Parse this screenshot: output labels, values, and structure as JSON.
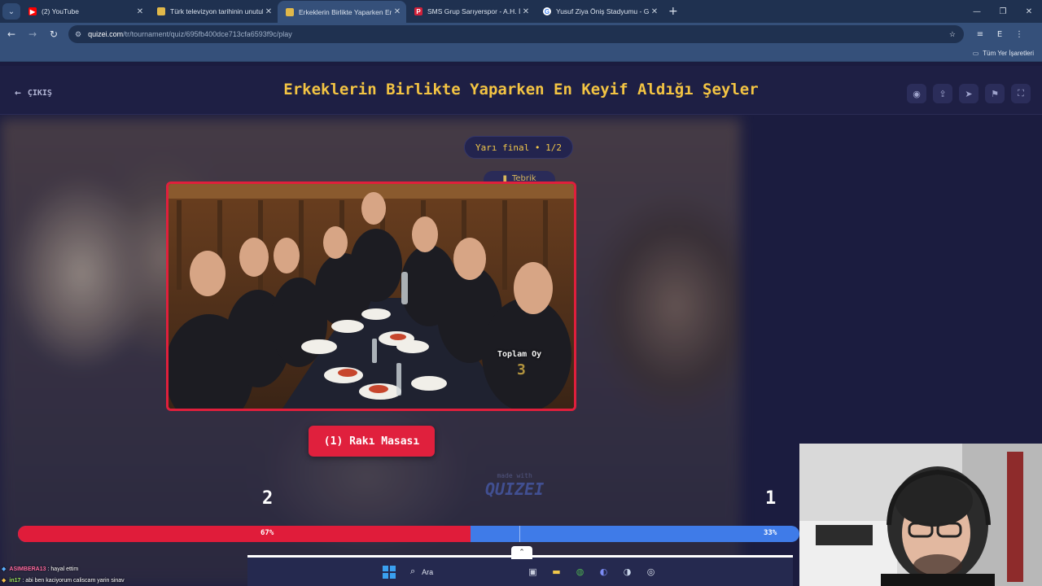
{
  "browser": {
    "tabs": [
      {
        "title": "(2) YouTube",
        "icon": "youtube-icon",
        "color": "#ff0000",
        "active": false
      },
      {
        "title": "Türk televizyon tarihinin unutul",
        "icon": "web-icon",
        "color": "#e0b84a",
        "active": false
      },
      {
        "title": "Erkeklerin Birlikte Yaparken En I",
        "icon": "quizei-icon",
        "color": "#e0b84a",
        "active": true
      },
      {
        "title": "SMS Grup Sarıyerspor - A.H. İğ",
        "icon": "p-icon",
        "color": "#d3213a",
        "active": false
      },
      {
        "title": "Yusuf Ziya Öniş Stadyumu - Go",
        "icon": "google-icon",
        "color": "#ffffff",
        "active": false
      }
    ],
    "url_host": "quizei.com",
    "url_path": "/tr/tournament/quiz/695fb400dce713cfa6593f9c/play",
    "profile_initial": "E",
    "bookmarks_label": "Tüm Yer İşaretleri"
  },
  "game": {
    "exit_label": "ÇIKIŞ",
    "title": "Erkeklerin Birlikte Yaparken En Keyif Aldığı Şeyler",
    "round_label": "Yarı final • 1/2",
    "share_label": "Tebrik",
    "vote_label": "Toplam Oy",
    "vote_count": "3",
    "choice_label": "(1) Rakı Masası",
    "watermark_small": "made with",
    "watermark_big": "QUIZEI",
    "score_left": "2",
    "score_right": "1",
    "percent_left_label": "67%",
    "percent_right_label": "33%",
    "percent_left": 0.67,
    "accent_color": "#f3c443",
    "left_color": "#e01c3a",
    "right_color": "#3f7be8"
  },
  "chat": [
    {
      "user": "ASIMBERA13",
      "message": ": hayal ettim"
    },
    {
      "user": "in17",
      "message": ": abi ben kaciyorum caliscam yarin sinav"
    }
  ],
  "taskbar": {
    "search_label": "Ara"
  }
}
